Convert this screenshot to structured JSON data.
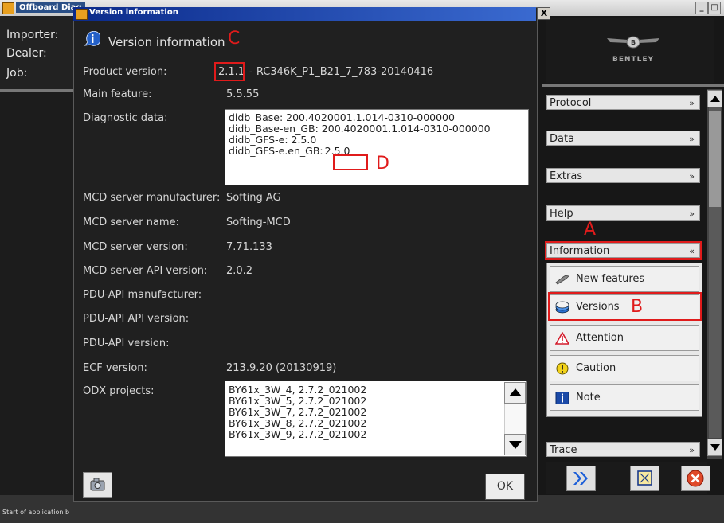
{
  "app": {
    "title": "Offboard Diag",
    "minimize_label": "_",
    "maximize_label": "□"
  },
  "left_info": {
    "importer_label": "Importer:",
    "dealer_label": "Dealer:",
    "job_label": "Job:"
  },
  "status": {
    "text": "Start of application b"
  },
  "right_panel": {
    "brand": "BENTLEY",
    "sections": [
      {
        "label": "Protocol",
        "chevron": "»"
      },
      {
        "label": "Data",
        "chevron": "»"
      },
      {
        "label": "Extras",
        "chevron": "»"
      },
      {
        "label": "Help",
        "chevron": "»"
      },
      {
        "label": "Information",
        "chevron": "«"
      },
      {
        "label": "Trace",
        "chevron": "»"
      }
    ],
    "info_items": [
      {
        "label": "New features",
        "icon": "wrench-icon"
      },
      {
        "label": "Versions",
        "icon": "disk-stack-icon"
      },
      {
        "label": "Attention",
        "icon": "warning-triangle-icon"
      },
      {
        "label": "Caution",
        "icon": "exclamation-circle-icon"
      },
      {
        "label": "Note",
        "icon": "info-square-icon"
      }
    ]
  },
  "dialog": {
    "title": "Version information",
    "close_label": "X",
    "header": "Version information",
    "product_version_label": "Product version:",
    "product_version_number": "2.1.1",
    "product_version_rest": "- RC346K_P1_B21_7_783-20140416",
    "main_feature_label": "Main feature:",
    "main_feature_value": "5.5.55",
    "diagnostic_data_label": "Diagnostic data:",
    "diagnostic_data": [
      "didb_Base: 200.4020001.1.014-0310-000000",
      "didb_Base-en_GB: 200.4020001.1.014-0310-000000",
      "didb_GFS-e: 2.5.0"
    ],
    "diagnostic_last_prefix": "didb_GFS-e.en_GB:",
    "diagnostic_last_value": "2.5.0",
    "fields": [
      {
        "label": "MCD server manufacturer:",
        "value": "Softing AG"
      },
      {
        "label": "MCD server name:",
        "value": "Softing-MCD"
      },
      {
        "label": "MCD server version:",
        "value": "7.71.133"
      },
      {
        "label": "MCD server API version:",
        "value": "2.0.2"
      },
      {
        "label": "PDU-API manufacturer:",
        "value": ""
      },
      {
        "label": "PDU-API API version:",
        "value": ""
      },
      {
        "label": "PDU-API version:",
        "value": ""
      },
      {
        "label": "ECF version:",
        "value": "213.9.20 (20130919)"
      }
    ],
    "odx_projects_label": "ODX projects:",
    "odx_projects": [
      "BY61x_3W_4, 2.7.2_021002",
      "BY61x_3W_5, 2.7.2_021002",
      "BY61x_3W_7, 2.7.2_021002",
      "BY61x_3W_8, 2.7.2_021002",
      "BY61x_3W_9, 2.7.2_021002"
    ],
    "ok_label": "OK"
  },
  "annotations": {
    "a": "A",
    "b": "B",
    "c": "C",
    "d": "D",
    "color": "#e01b1b"
  }
}
